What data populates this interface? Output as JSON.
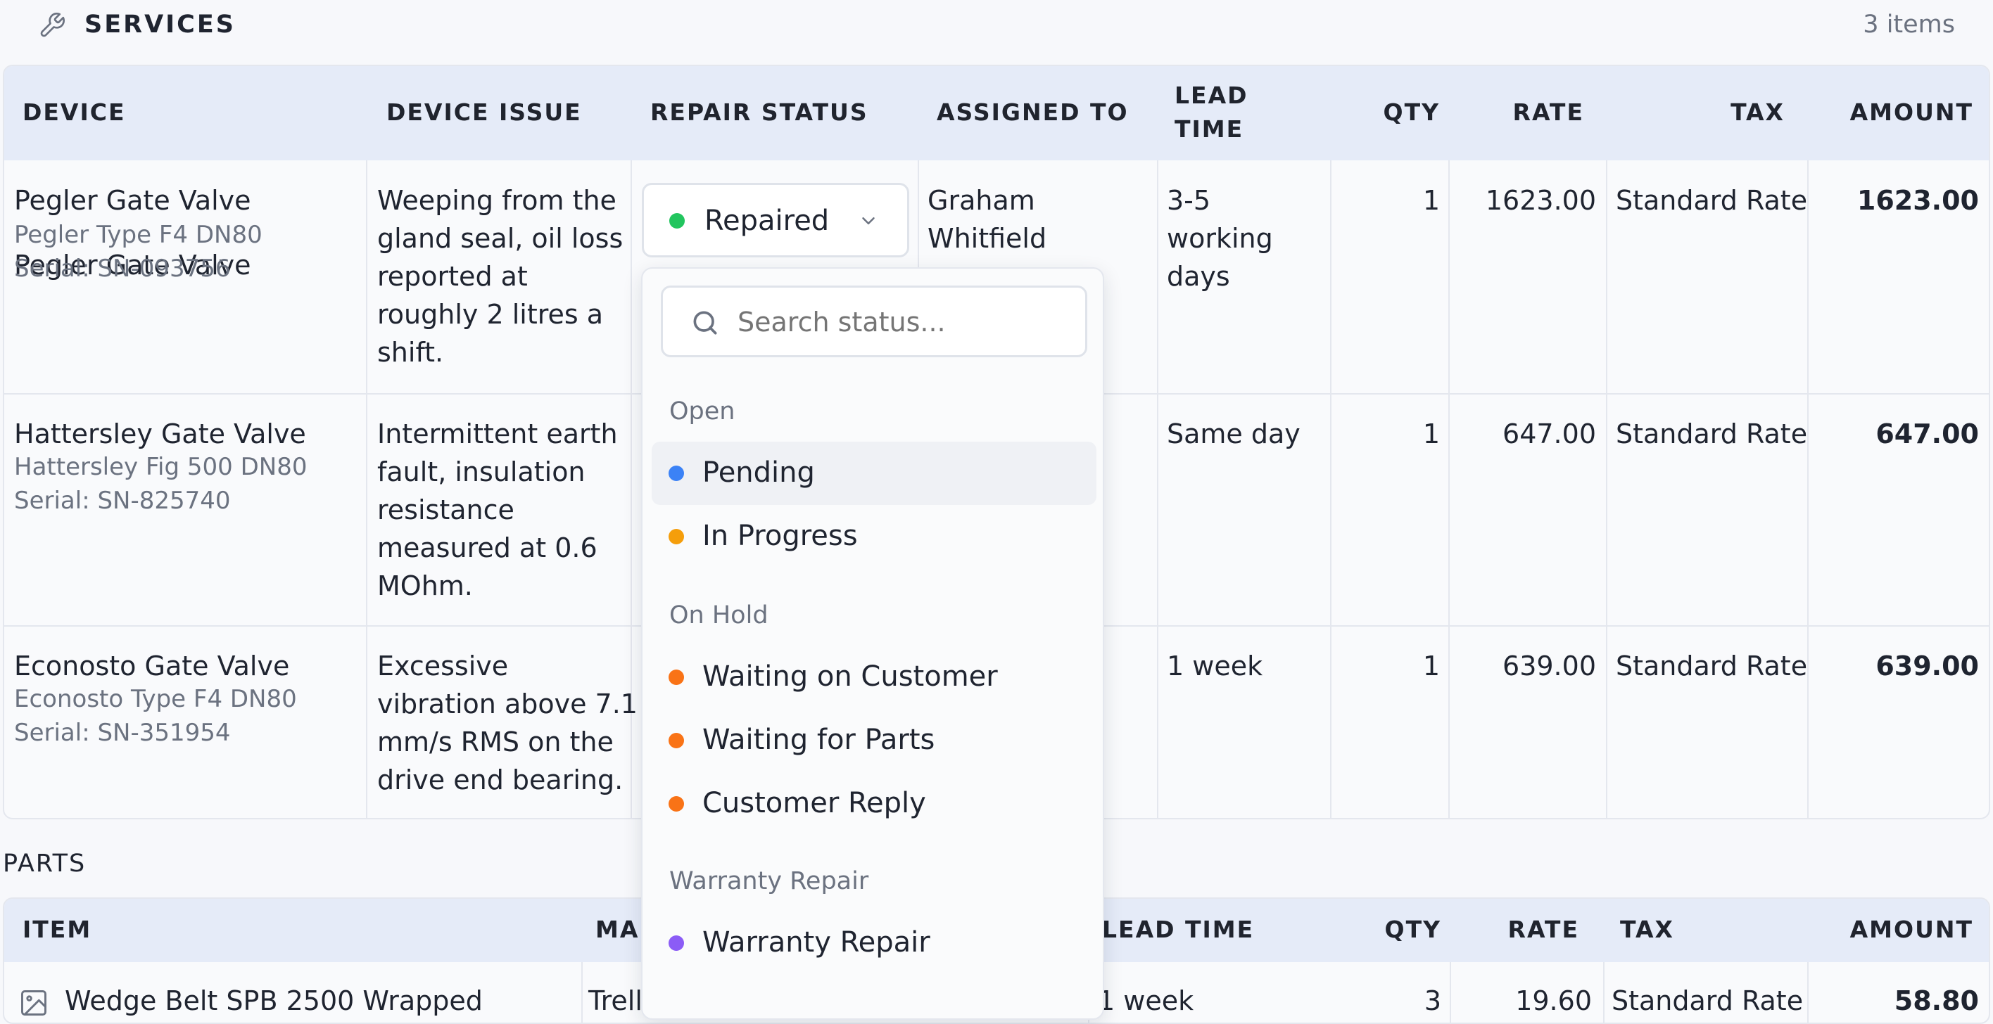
{
  "services": {
    "title": "SERVICES",
    "count": "3 items",
    "columns": {
      "device": "DEVICE",
      "issue": "DEVICE ISSUE",
      "status": "REPAIR STATUS",
      "assigned": "ASSIGNED TO",
      "lead_line1": "LEAD",
      "lead_line2": "TIME",
      "qty": "QTY",
      "rate": "RATE",
      "tax": "TAX",
      "amount": "AMOUNT"
    },
    "rows": [
      {
        "device": "Pegler Gate Valve",
        "model": "Pegler Type F4 DN80",
        "serial": "Serial: SN-093756",
        "issue": [
          "Weeping from the",
          "gland seal, oil loss",
          "reported at",
          "roughly 2 litres a",
          "shift."
        ],
        "status": "Repaired",
        "assigned": [
          "Graham",
          "Whitfield"
        ],
        "lead": [
          "3-5",
          "working",
          "days"
        ],
        "qty": "1",
        "rate": "1623.00",
        "tax": "Standard Rate",
        "amount": "1623.00"
      },
      {
        "device": "Hattersley Gate Valve",
        "model": "Hattersley Fig 500 DN80",
        "serial": "Serial: SN-825740",
        "issue": [
          "Intermittent earth",
          "fault, insulation",
          "resistance",
          "measured at 0.6",
          "MOhm."
        ],
        "lead": [
          "Same day"
        ],
        "qty": "1",
        "rate": "647.00",
        "tax": "Standard Rate",
        "amount": "647.00"
      },
      {
        "device": "Econosto Gate Valve",
        "model": "Econosto Type F4 DN80",
        "serial": "Serial: SN-351954",
        "issue": [
          "Excessive",
          "vibration above 7.1",
          "mm/s RMS on the",
          "drive end bearing."
        ],
        "lead": [
          "1 week"
        ],
        "qty": "1",
        "rate": "639.00",
        "tax": "Standard Rate",
        "amount": "639.00"
      }
    ]
  },
  "parts": {
    "title": "PARTS",
    "columns": {
      "item": "ITEM",
      "manufacturer": "MA",
      "lead": "LEAD TIME",
      "qty": "QTY",
      "rate": "RATE",
      "tax": "TAX",
      "amount": "AMOUNT"
    },
    "row": {
      "item": "Wedge Belt SPB 2500 Wrapped",
      "manufacturer": "Trelleborg",
      "lead": "1 week",
      "qty": "3",
      "rate": "19.60",
      "tax": "Standard Rate",
      "amount": "58.80"
    }
  },
  "dropdown": {
    "search_placeholder": "Search status...",
    "groups": [
      {
        "label": "Open",
        "options": [
          {
            "label": "Pending",
            "color": "#3b82f6"
          },
          {
            "label": "In Progress",
            "color": "#f59e0b"
          }
        ]
      },
      {
        "label": "On Hold",
        "options": [
          {
            "label": "Waiting on Customer",
            "color": "#f97316"
          },
          {
            "label": "Waiting for Parts",
            "color": "#f97316"
          },
          {
            "label": "Customer Reply",
            "color": "#f97316"
          }
        ]
      },
      {
        "label": "Warranty Repair",
        "options": [
          {
            "label": "Warranty Repair",
            "color": "#8b5cf6"
          }
        ]
      }
    ]
  },
  "colors": {
    "header_bg": "#e5ebf8",
    "repaired": "#22c55e"
  }
}
